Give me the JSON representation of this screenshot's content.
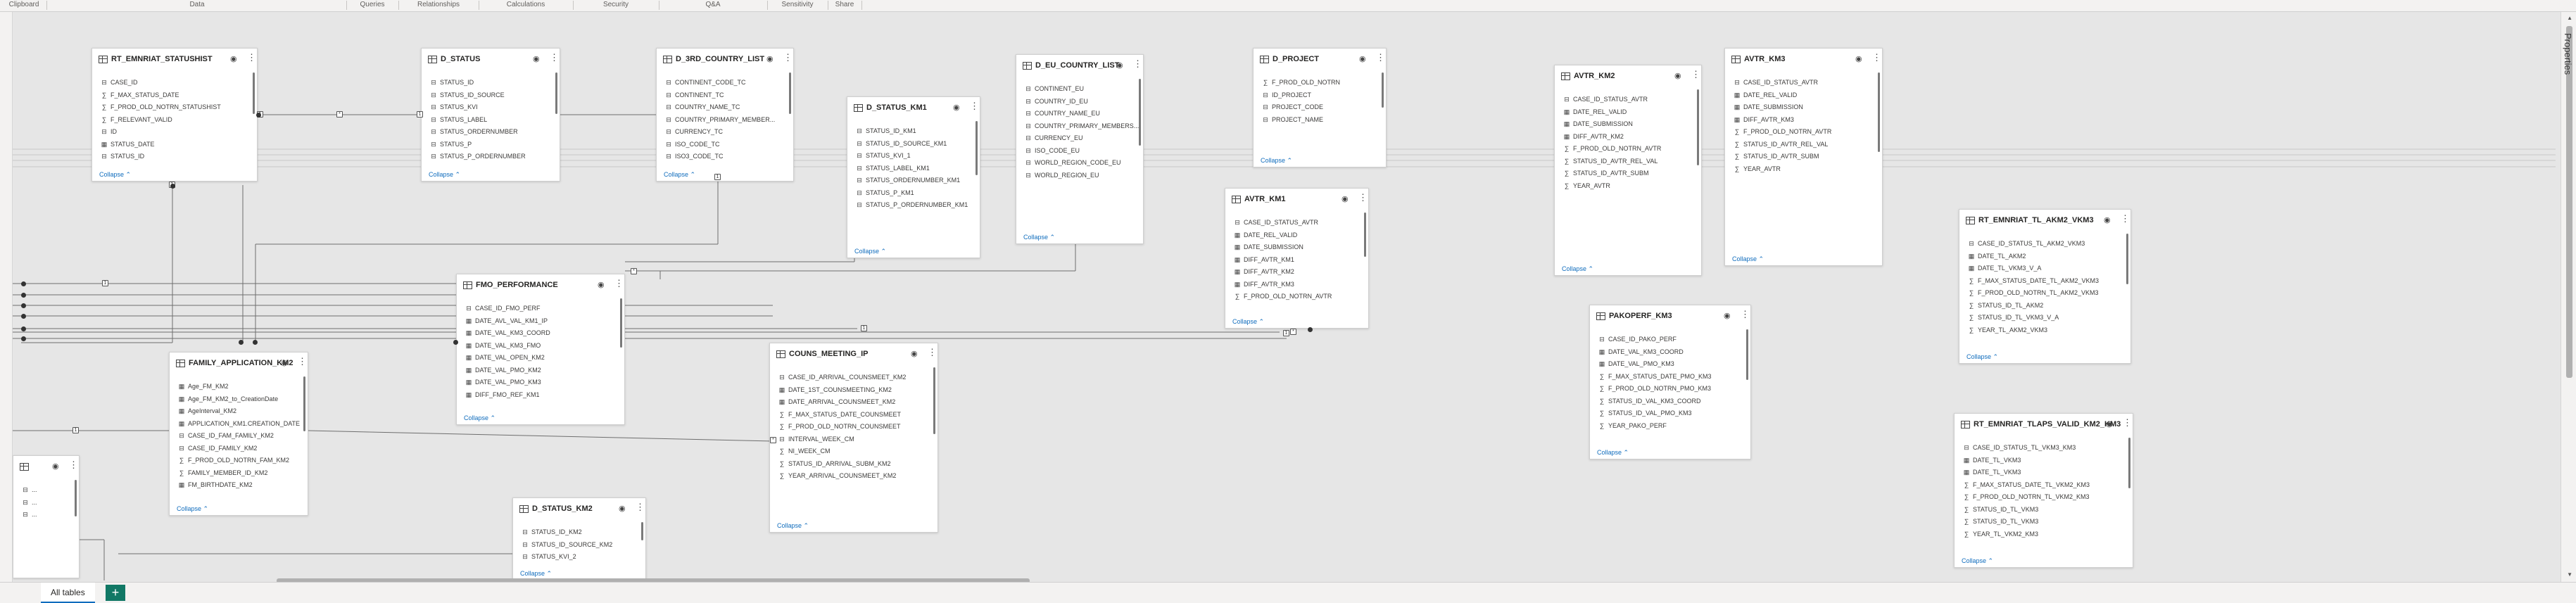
{
  "ribbon": {
    "groups": [
      "Clipboard",
      "Data",
      "Queries",
      "Relationships",
      "Calculations",
      "Security",
      "Q&A",
      "Sensitivity",
      "Share"
    ]
  },
  "tabs": {
    "all_tables": "All tables"
  },
  "panes": {
    "properties": "Properties"
  },
  "collapse_label": "Collapse",
  "tables": [
    {
      "title": "RT_EMNRIAT_STATUSHIST",
      "fields": [
        {
          "icon": "key",
          "name": "CASE_ID"
        },
        {
          "icon": "sigma",
          "name": "F_MAX_STATUS_DATE"
        },
        {
          "icon": "sigma",
          "name": "F_PROD_OLD_NOTRN_STATUSHIST"
        },
        {
          "icon": "sigma",
          "name": "F_RELEVANT_VALID"
        },
        {
          "icon": "key",
          "name": "ID"
        },
        {
          "icon": "calendar",
          "name": "STATUS_DATE"
        },
        {
          "icon": "key",
          "name": "STATUS_ID"
        }
      ]
    },
    {
      "title": "D_STATUS",
      "fields": [
        {
          "icon": "key",
          "name": "STATUS_ID"
        },
        {
          "icon": "key",
          "name": "STATUS_ID_SOURCE"
        },
        {
          "icon": "key",
          "name": "STATUS_KVI"
        },
        {
          "icon": "key",
          "name": "STATUS_LABEL"
        },
        {
          "icon": "key",
          "name": "STATUS_ORDERNUMBER"
        },
        {
          "icon": "key",
          "name": "STATUS_P"
        },
        {
          "icon": "key",
          "name": "STATUS_P_ORDERNUMBER"
        }
      ]
    },
    {
      "title": "D_3RD_COUNTRY_LIST",
      "fields": [
        {
          "icon": "key",
          "name": "CONTINENT_CODE_TC"
        },
        {
          "icon": "key",
          "name": "CONTINENT_TC"
        },
        {
          "icon": "key",
          "name": "COUNTRY_NAME_TC"
        },
        {
          "icon": "key",
          "name": "COUNTRY_PRIMARY_MEMBER..."
        },
        {
          "icon": "key",
          "name": "CURRENCY_TC"
        },
        {
          "icon": "key",
          "name": "ISO_CODE_TC"
        },
        {
          "icon": "key",
          "name": "ISO3_CODE_TC"
        }
      ]
    },
    {
      "title": "D_STATUS_KM1",
      "fields": [
        {
          "icon": "key",
          "name": "STATUS_ID_KM1"
        },
        {
          "icon": "key",
          "name": "STATUS_ID_SOURCE_KM1"
        },
        {
          "icon": "key",
          "name": "STATUS_KVI_1"
        },
        {
          "icon": "key",
          "name": "STATUS_LABEL_KM1"
        },
        {
          "icon": "key",
          "name": "STATUS_ORDERNUMBER_KM1"
        },
        {
          "icon": "key",
          "name": "STATUS_P_KM1"
        },
        {
          "icon": "key",
          "name": "STATUS_P_ORDERNUMBER_KM1"
        }
      ]
    },
    {
      "title": "D_EU_COUNTRY_LIST",
      "fields": [
        {
          "icon": "key",
          "name": "CONTINENT_EU"
        },
        {
          "icon": "key",
          "name": "COUNTRY_ID_EU"
        },
        {
          "icon": "key",
          "name": "COUNTRY_NAME_EU"
        },
        {
          "icon": "key",
          "name": "COUNTRY_PRIMARY_MEMBERS..."
        },
        {
          "icon": "key",
          "name": "CURRENCY_EU"
        },
        {
          "icon": "key",
          "name": "ISO_CODE_EU"
        },
        {
          "icon": "key",
          "name": "WORLD_REGION_CODE_EU"
        },
        {
          "icon": "key",
          "name": "WORLD_REGION_EU"
        }
      ]
    },
    {
      "title": "D_PROJECT",
      "fields": [
        {
          "icon": "sigma",
          "name": "F_PROD_OLD_NOTRN"
        },
        {
          "icon": "key",
          "name": "ID_PROJECT"
        },
        {
          "icon": "key",
          "name": "PROJECT_CODE"
        },
        {
          "icon": "key",
          "name": "PROJECT_NAME"
        }
      ]
    },
    {
      "title": "AVTR_KM2",
      "fields": [
        {
          "icon": "key",
          "name": "CASE_ID_STATUS_AVTR"
        },
        {
          "icon": "calendar",
          "name": "DATE_REL_VALID"
        },
        {
          "icon": "calendar",
          "name": "DATE_SUBMISSION"
        },
        {
          "icon": "calendar",
          "name": "DIFF_AVTR_KM2"
        },
        {
          "icon": "sigma",
          "name": "F_PROD_OLD_NOTRN_AVTR"
        },
        {
          "icon": "sigma",
          "name": "STATUS_ID_AVTR_REL_VAL"
        },
        {
          "icon": "sigma",
          "name": "STATUS_ID_AVTR_SUBM"
        },
        {
          "icon": "sigma",
          "name": "YEAR_AVTR"
        }
      ]
    },
    {
      "title": "AVTR_KM3",
      "fields": [
        {
          "icon": "key",
          "name": "CASE_ID_STATUS_AVTR"
        },
        {
          "icon": "calendar",
          "name": "DATE_REL_VALID"
        },
        {
          "icon": "calendar",
          "name": "DATE_SUBMISSION"
        },
        {
          "icon": "calendar",
          "name": "DIFF_AVTR_KM3"
        },
        {
          "icon": "sigma",
          "name": "F_PROD_OLD_NOTRN_AVTR"
        },
        {
          "icon": "sigma",
          "name": "STATUS_ID_AVTR_REL_VAL"
        },
        {
          "icon": "sigma",
          "name": "STATUS_ID_AVTR_SUBM"
        },
        {
          "icon": "sigma",
          "name": "YEAR_AVTR"
        }
      ]
    },
    {
      "title": "AVTR_KM1",
      "fields": [
        {
          "icon": "key",
          "name": "CASE_ID_STATUS_AVTR"
        },
        {
          "icon": "calendar",
          "name": "DATE_REL_VALID"
        },
        {
          "icon": "calendar",
          "name": "DATE_SUBMISSION"
        },
        {
          "icon": "calendar",
          "name": "DIFF_AVTR_KM1"
        },
        {
          "icon": "calendar",
          "name": "DIFF_AVTR_KM2"
        },
        {
          "icon": "calendar",
          "name": "DIFF_AVTR_KM3"
        },
        {
          "icon": "sigma",
          "name": "F_PROD_OLD_NOTRN_AVTR"
        }
      ]
    },
    {
      "title": "RT_EMNRIAT_TL_AKM2_VKM3",
      "fields": [
        {
          "icon": "key",
          "name": "CASE_ID_STATUS_TL_AKM2_VKM3"
        },
        {
          "icon": "calendar",
          "name": "DATE_TL_AKM2"
        },
        {
          "icon": "calendar",
          "name": "DATE_TL_VKM3_V_A"
        },
        {
          "icon": "sigma",
          "name": "F_MAX_STATUS_DATE_TL_AKM2_VKM3"
        },
        {
          "icon": "sigma",
          "name": "F_PROD_OLD_NOTRN_TL_AKM2_VKM3"
        },
        {
          "icon": "sigma",
          "name": "STATUS_ID_TL_AKM2"
        },
        {
          "icon": "sigma",
          "name": "STATUS_ID_TL_VKM3_V_A"
        },
        {
          "icon": "sigma",
          "name": "YEAR_TL_AKM2_VKM3"
        }
      ]
    },
    {
      "title": "FMO_PERFORMANCE",
      "fields": [
        {
          "icon": "key",
          "name": "CASE_ID_FMO_PERF"
        },
        {
          "icon": "calendar",
          "name": "DATE_AVL_VAL_KM1_IP"
        },
        {
          "icon": "calendar",
          "name": "DATE_VAL_KM3_COORD"
        },
        {
          "icon": "calendar",
          "name": "DATE_VAL_KM3_FMO"
        },
        {
          "icon": "calendar",
          "name": "DATE_VAL_OPEN_KM2"
        },
        {
          "icon": "calendar",
          "name": "DATE_VAL_PMO_KM2"
        },
        {
          "icon": "calendar",
          "name": "DATE_VAL_PMO_KM3"
        },
        {
          "icon": "calendar",
          "name": "DIFF_FMO_REF_KM1"
        }
      ]
    },
    {
      "title": "FAMILY_APPLICATION_KM2",
      "fields": [
        {
          "icon": "calendar",
          "name": "Age_FM_KM2"
        },
        {
          "icon": "calendar",
          "name": "Age_FM_KM2_to_CreationDate"
        },
        {
          "icon": "calendar",
          "name": "AgeInterval_KM2"
        },
        {
          "icon": "calendar",
          "name": "APPLICATION_KM1.CREATION_DATE"
        },
        {
          "icon": "key",
          "name": "CASE_ID_FAM_FAMILY_KM2"
        },
        {
          "icon": "key",
          "name": "CASE_ID_FAMILY_KM2"
        },
        {
          "icon": "sigma",
          "name": "F_PROD_OLD_NOTRN_FAM_KM2"
        },
        {
          "icon": "sigma",
          "name": "FAMILY_MEMBER_ID_KM2"
        },
        {
          "icon": "calendar",
          "name": "FM_BIRTHDATE_KM2"
        }
      ]
    },
    {
      "title": "COUNS_MEETING_IP",
      "fields": [
        {
          "icon": "key",
          "name": "CASE_ID_ARRIVAL_COUNSMEET_KM2"
        },
        {
          "icon": "calendar",
          "name": "DATE_1ST_COUNSMEETING_KM2"
        },
        {
          "icon": "calendar",
          "name": "DATE_ARRIVAL_COUNSMEET_KM2"
        },
        {
          "icon": "sigma",
          "name": "F_MAX_STATUS_DATE_COUNSMEET"
        },
        {
          "icon": "sigma",
          "name": "F_PROD_OLD_NOTRN_COUNSMEET"
        },
        {
          "icon": "key",
          "name": "INTERVAL_WEEK_CM"
        },
        {
          "icon": "sigma",
          "name": "NI_WEEK_CM"
        },
        {
          "icon": "sigma",
          "name": "STATUS_ID_ARRIVAL_SUBM_KM2"
        },
        {
          "icon": "sigma",
          "name": "YEAR_ARRIVAL_COUNSMEET_KM2"
        }
      ]
    },
    {
      "title": "PAKOPERF_KM3",
      "fields": [
        {
          "icon": "key",
          "name": "CASE_ID_PAKO_PERF"
        },
        {
          "icon": "calendar",
          "name": "DATE_VAL_KM3_COORD"
        },
        {
          "icon": "calendar",
          "name": "DATE_VAL_PMO_KM3"
        },
        {
          "icon": "sigma",
          "name": "F_MAX_STATUS_DATE_PMO_KM3"
        },
        {
          "icon": "sigma",
          "name": "F_PROD_OLD_NOTRN_PMO_KM3"
        },
        {
          "icon": "sigma",
          "name": "STATUS_ID_VAL_KM3_COORD"
        },
        {
          "icon": "sigma",
          "name": "STATUS_ID_VAL_PMO_KM3"
        },
        {
          "icon": "sigma",
          "name": "YEAR_PAKO_PERF"
        }
      ]
    },
    {
      "title": "D_STATUS_KM2",
      "fields": [
        {
          "icon": "key",
          "name": "STATUS_ID_KM2"
        },
        {
          "icon": "key",
          "name": "STATUS_ID_SOURCE_KM2"
        },
        {
          "icon": "key",
          "name": "STATUS_KVI_2"
        },
        {
          "icon": "key",
          "name": "STATUS_LABEL_KM2"
        },
        {
          "icon": "key",
          "name": "STATUS_ORDERNUMBER_KM2"
        }
      ]
    },
    {
      "title": "RT_EMNRIAT_TLAPS_VALID_KM2_KM3",
      "fields": [
        {
          "icon": "key",
          "name": "CASE_ID_STATUS_TL_VKM3_KM3"
        },
        {
          "icon": "calendar",
          "name": "DATE_TL_VKM3"
        },
        {
          "icon": "calendar",
          "name": "DATE_TL_VKM3"
        },
        {
          "icon": "sigma",
          "name": "F_MAX_STATUS_DATE_TL_VKM2_KM3"
        },
        {
          "icon": "sigma",
          "name": "F_PROD_OLD_NOTRN_TL_VKM2_KM3"
        },
        {
          "icon": "sigma",
          "name": "STATUS_ID_TL_VKM3"
        },
        {
          "icon": "sigma",
          "name": "STATUS_ID_TL_VKM3"
        },
        {
          "icon": "sigma",
          "name": "YEAR_TL_VKM2_KM3"
        }
      ]
    },
    {
      "title": "",
      "fields": [
        {
          "icon": "key",
          "name": "..."
        },
        {
          "icon": "key",
          "name": "..."
        },
        {
          "icon": "key",
          "name": "..."
        }
      ]
    }
  ]
}
